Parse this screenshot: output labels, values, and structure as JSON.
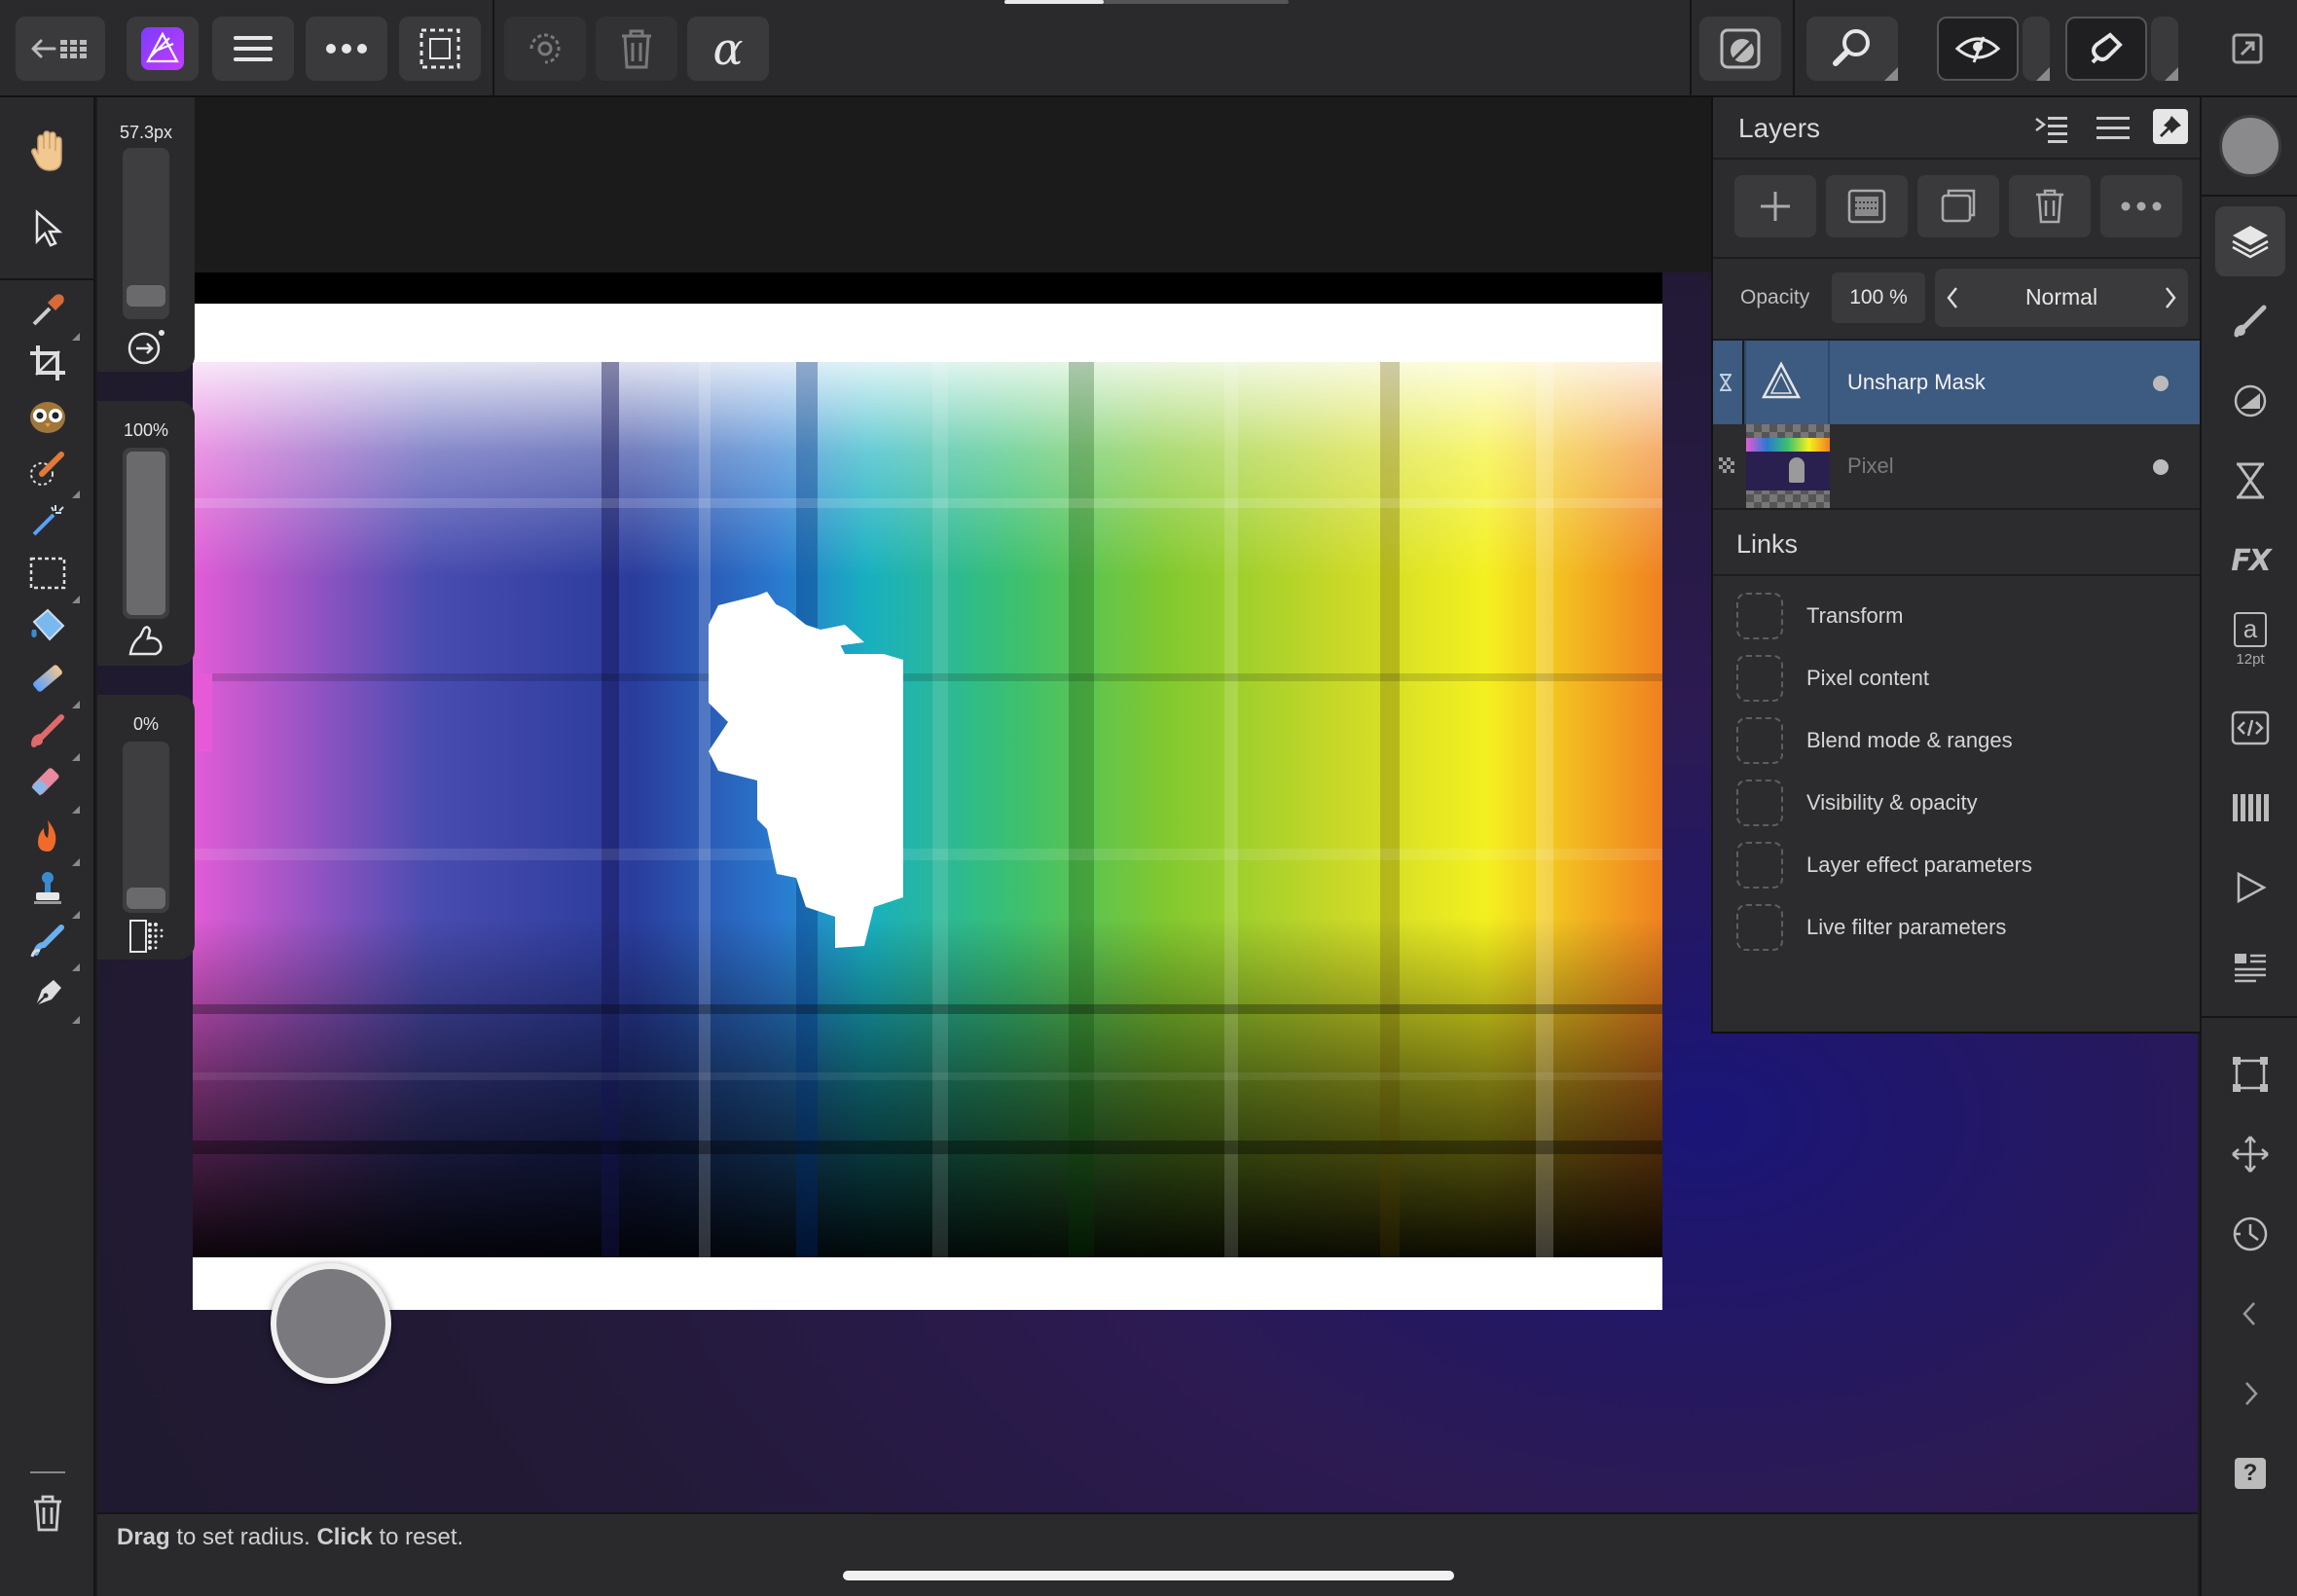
{
  "top_toolbar": {
    "buttons": [
      {
        "name": "back-to-documents-button",
        "icon": "back-grid-icon"
      },
      {
        "name": "persona-photo-button",
        "icon": "affinity-photo-icon"
      },
      {
        "name": "menu-button",
        "icon": "hamburger-icon"
      },
      {
        "name": "more-button",
        "icon": "ellipsis-icon"
      },
      {
        "name": "selection-button",
        "icon": "marquee-icon"
      },
      {
        "name": "transform-selection-button",
        "icon": "rotate-selection-icon"
      },
      {
        "name": "delete-selection-button",
        "icon": "trash-icon"
      },
      {
        "name": "alpha-button",
        "icon": "alpha-icon",
        "glyph": "α"
      },
      {
        "name": "quick-mask-button",
        "icon": "quick-mask-icon"
      },
      {
        "name": "zoom-button",
        "icon": "magnifier-icon"
      },
      {
        "name": "view-mode-button",
        "icon": "eye-icon"
      },
      {
        "name": "snapping-button",
        "icon": "magnet-icon"
      },
      {
        "name": "fullscreen-button",
        "icon": "expand-icon"
      }
    ],
    "load_progress": 0.35
  },
  "left_tools": [
    "hand-tool",
    "move-tool",
    "color-picker-tool",
    "crop-tool",
    "red-eye-tool",
    "selection-brush-tool",
    "flood-select-tool",
    "rectangle-marquee-tool",
    "flood-fill-tool",
    "gradient-tool",
    "paint-brush-tool",
    "erase-brush-tool",
    "dodge-burn-tool",
    "clone-tool",
    "retouch-brush-tool",
    "pen-tool"
  ],
  "sliders": {
    "size": {
      "label": "57.3px",
      "level": 0.06
    },
    "opacity": {
      "label": "100%",
      "level": 1.0
    },
    "hardness": {
      "label": "0%",
      "level": 0.0
    }
  },
  "layers_panel": {
    "title": "Layers",
    "opacity_label": "Opacity",
    "opacity_value": "100 %",
    "blend_mode": "Normal",
    "layers": [
      {
        "name": "Unsharp Mask",
        "selected": true
      },
      {
        "name": "Pixel",
        "selected": false
      }
    ],
    "links_title": "Links",
    "links": [
      "Transform",
      "Pixel content",
      "Blend mode & ranges",
      "Visibility & opacity",
      "Layer effect parameters",
      "Live filter parameters"
    ]
  },
  "studio": {
    "font_size": "12pt",
    "icons": [
      "layers-icon",
      "brushes-icon",
      "adjustments-icon",
      "hourglass-icon",
      "fx-icon",
      "character-icon",
      "code-icon",
      "swatches-icon",
      "play-icon",
      "navigator-icon",
      "transform-icon",
      "move-icon",
      "history-icon",
      "collapse-icon",
      "expand-icon",
      "help-icon"
    ]
  },
  "status": {
    "drag": "Drag",
    "drag_rest": " to set radius. ",
    "click": "Click",
    "click_rest": " to reset."
  },
  "colors": {
    "selected_layer": "#3d5a80",
    "panel": "#2c2c2e",
    "toolbar": "#2a2a2c"
  }
}
